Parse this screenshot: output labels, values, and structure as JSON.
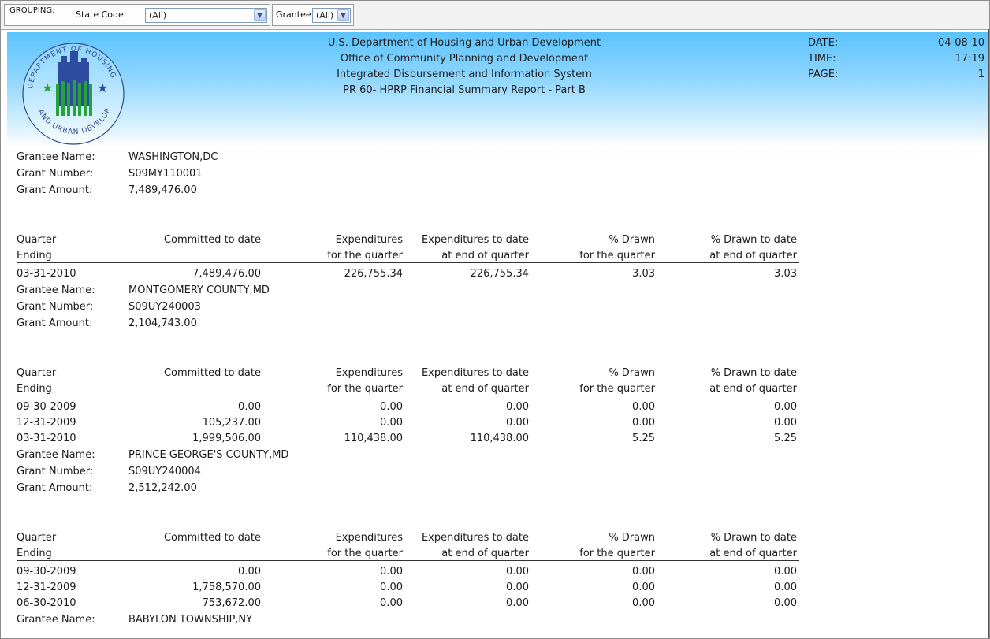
{
  "toolbar": {
    "grouping_label": "GROUPING:",
    "state_label": "State Code:",
    "state_value": "(All)",
    "grantee_label": "Grantee:",
    "grantee_value": "(All)"
  },
  "header": {
    "lines": [
      "U.S. Department of Housing and Urban Development",
      "Office of Community Planning and Development",
      "Integrated Disbursement and Information System",
      "PR 60-  HPRP Financial Summary Report - Part B"
    ],
    "seal_top_text": "DEPARTMENT OF HOUSING",
    "seal_bottom_text": "AND URBAN DEVELOPMENT",
    "date_label": "DATE:",
    "time_label": "TIME:",
    "page_label": "PAGE:",
    "date_value": "04-08-10",
    "time_value": "17:19",
    "page_value": "1"
  },
  "columns": {
    "quarter": "Quarter",
    "ending": "Ending",
    "committed": "Committed to date",
    "exp_q_1": "Expenditures",
    "exp_q_2": "for the quarter",
    "exp_td_1": "Expenditures to date",
    "exp_td_2": "at end of quarter",
    "drawn_q_1": "% Drawn",
    "drawn_q_2": "for the quarter",
    "drawn_td_1": "% Drawn to date",
    "drawn_td_2": "at end of quarter"
  },
  "labels": {
    "grantee_name": "Grantee Name:",
    "grant_number": "Grant Number:",
    "grant_amount": "Grant Amount:"
  },
  "grantees": [
    {
      "name": "WASHINGTON,DC",
      "number": "S09MY110001",
      "amount": "7,489,476.00",
      "rows": [
        [
          "03-31-2010",
          "7,489,476.00",
          "226,755.34",
          "226,755.34",
          "3.03",
          "3.03"
        ]
      ]
    },
    {
      "name": "MONTGOMERY COUNTY,MD",
      "number": "S09UY240003",
      "amount": "2,104,743.00",
      "rows": [
        [
          "09-30-2009",
          "0.00",
          "0.00",
          "0.00",
          "0.00",
          "0.00"
        ],
        [
          "12-31-2009",
          "105,237.00",
          "0.00",
          "0.00",
          "0.00",
          "0.00"
        ],
        [
          "03-31-2010",
          "1,999,506.00",
          "110,438.00",
          "110,438.00",
          "5.25",
          "5.25"
        ]
      ]
    },
    {
      "name": "PRINCE GEORGE'S COUNTY,MD",
      "number": "S09UY240004",
      "amount": "2,512,242.00",
      "rows": [
        [
          "09-30-2009",
          "0.00",
          "0.00",
          "0.00",
          "0.00",
          "0.00"
        ],
        [
          "12-31-2009",
          "1,758,570.00",
          "0.00",
          "0.00",
          "0.00",
          "0.00"
        ],
        [
          "06-30-2010",
          "753,672.00",
          "0.00",
          "0.00",
          "0.00",
          "0.00"
        ]
      ]
    },
    {
      "name": "BABYLON TOWNSHIP,NY"
    }
  ]
}
